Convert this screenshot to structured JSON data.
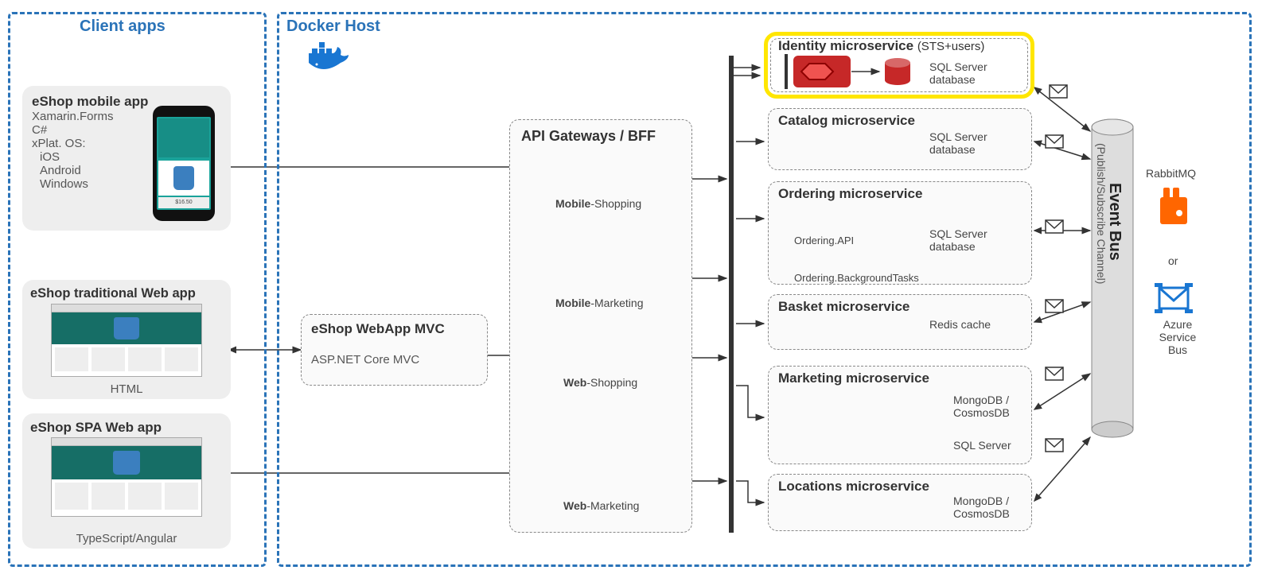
{
  "clientapps_title": "Client apps",
  "dockerhost_title": "Docker Host",
  "mobile": {
    "title": "eShop mobile app",
    "line1": "Xamarin.Forms",
    "line2": "C#",
    "line3": "xPlat. OS:",
    "line4": "iOS",
    "line5": "Android",
    "line6": "Windows"
  },
  "traditional": {
    "title": "eShop traditional Web app",
    "sub": "HTML"
  },
  "spa": {
    "title": "eShop SPA Web app",
    "sub": "TypeScript/Angular"
  },
  "mvc": {
    "title": "eShop WebApp MVC",
    "sub": "ASP.NET Core MVC"
  },
  "gateways": {
    "title": "API Gateways / BFF",
    "mobile_shopping_b": "Mobile",
    "mobile_shopping": "-Shopping",
    "mobile_marketing_b": "Mobile",
    "mobile_marketing": "-Marketing",
    "web_shopping_b": "Web",
    "web_shopping": "-Shopping",
    "web_marketing_b": "Web",
    "web_marketing": "-Marketing"
  },
  "services": {
    "identity_title": "Identity microservice ",
    "identity_paren": "(STS+users)",
    "identity_db": "SQL Server database",
    "catalog_title": "Catalog microservice",
    "catalog_db": "SQL Server database",
    "ordering_title": "Ordering microservice",
    "ordering_api": "Ordering.API",
    "ordering_bg": "Ordering.BackgroundTasks",
    "ordering_db": "SQL Server database",
    "basket_title": "Basket microservice",
    "basket_db": "Redis cache",
    "marketing_title": "Marketing microservice",
    "marketing_db1": "MongoDB / CosmosDB",
    "marketing_db2": "SQL Server",
    "locations_title": "Locations microservice",
    "locations_db": "MongoDB / CosmosDB"
  },
  "bus": {
    "title": "Event Bus",
    "sub": "(Publish/Subscribe Channel)",
    "rabbit": "RabbitMQ",
    "or": "or",
    "azure1": "Azure",
    "azure2": "Service Bus"
  },
  "colors": {
    "blue": "#2a73b8",
    "gray": "#555",
    "yellow_hl": "#ffe600",
    "red": "#c62828",
    "navy": "#0b2a4a",
    "green": "#2e7d32",
    "lgreen": "#43a047",
    "mblue": "#1976d2",
    "cyan": "#03a9f4",
    "orange": "#f9a825",
    "dark": "#333"
  }
}
